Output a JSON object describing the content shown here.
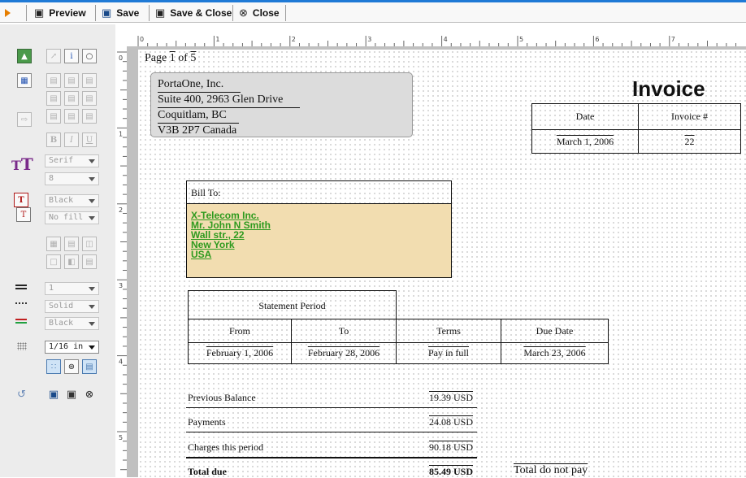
{
  "toolbar": {
    "preview_label": "Preview",
    "save_label": "Save",
    "save_close_label": "Save & Close",
    "close_label": "Close"
  },
  "panel": {
    "font_family": "Serif",
    "font_size": "8",
    "text_color": "Black",
    "fill_color": "No fill",
    "line_width": "1",
    "line_style": "Solid",
    "line_color": "Black",
    "grid_size": "1/16 in"
  },
  "ruler": {
    "h_labels": [
      "0",
      "1",
      "2",
      "3",
      "4",
      "5",
      "6",
      "7",
      "8"
    ],
    "v_labels": [
      "0",
      "1",
      "2",
      "3",
      "4",
      "5"
    ]
  },
  "page": {
    "page_prefix": "Page",
    "page_num": "1",
    "page_of": "of",
    "page_total": "5",
    "company_lines": [
      "PortaOne, Inc.",
      "Suite 400, 2963 Glen Drive",
      "Coquitlam, BC",
      "V3B 2P7 Canada"
    ],
    "invoice_title": "Invoice",
    "date_header": "Date",
    "invoice_num_header": "Invoice #",
    "date_value": "March 1, 2006",
    "invoice_num_value": "22",
    "bill_to_label": "Bill To:",
    "bill_to_lines": [
      "X-Telecom Inc.",
      "Mr. John N Smith",
      "Wall str., 22",
      "New York",
      "USA"
    ],
    "statement_period_label": "Statement Period",
    "from_header": "From",
    "to_header": "To",
    "terms_header": "Terms",
    "due_date_header": "Due Date",
    "from_value": "February 1, 2006",
    "to_value": "February 28, 2006",
    "terms_value": "Pay in full",
    "due_date_value": "March 23, 2006",
    "summary": [
      {
        "label": "Previous Balance",
        "amount": "19.39",
        "currency": "USD"
      },
      {
        "label": "Payments",
        "amount": "24.08",
        "currency": "USD"
      },
      {
        "label": "Charges this period",
        "amount": "90.18",
        "currency": "USD"
      },
      {
        "label": "Total due",
        "amount": "85.49",
        "currency": "USD"
      }
    ],
    "total_do_not_pay": "Total do not pay"
  },
  "colors": {
    "accent": "#1f7ad6",
    "bill_to_fill": "#f2ddb0",
    "bill_to_text": "#2e9a1e",
    "company_fill": "#dcdcdc"
  }
}
